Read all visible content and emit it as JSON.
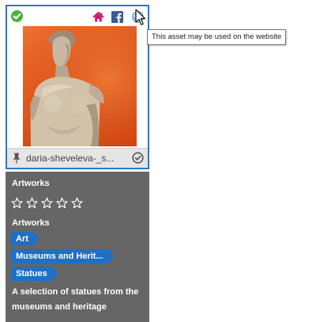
{
  "asset": {
    "filename": "daria-sheveleva-_s...",
    "share_icons": [
      "home-icon",
      "facebook-icon",
      "wordpress-icon"
    ]
  },
  "tooltip": {
    "text": "This asset may be used on the website"
  },
  "details": {
    "title": "Artworks",
    "rating": {
      "value": 0,
      "max": 5
    },
    "category": "Artworks",
    "tags": [
      "Art",
      "Museums and Herit...",
      "Statues"
    ],
    "description": "A selection of statues from the museums and heritage"
  },
  "colors": {
    "accent": "#2d78c4",
    "tag": "#1f6fc5",
    "panel": "#666666",
    "check": "#46b53a",
    "home": "#c81e6b",
    "facebook": "#3b5998",
    "wordpress": "#3d7fbf"
  }
}
